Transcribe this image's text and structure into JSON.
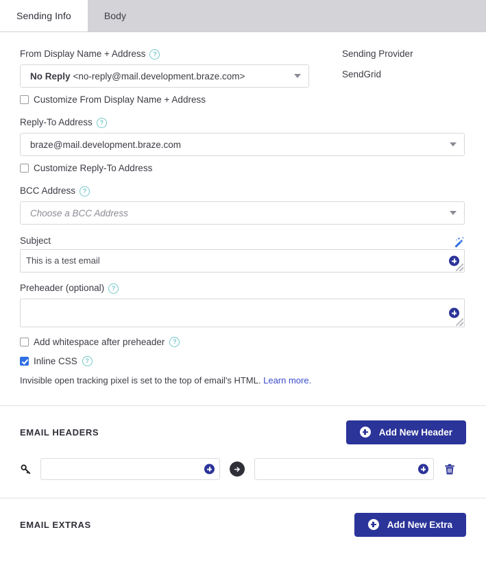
{
  "tabs": [
    {
      "label": "Sending Info",
      "active": true
    },
    {
      "label": "Body",
      "active": false
    }
  ],
  "form": {
    "from": {
      "label": "From Display Name + Address",
      "display_name": "No Reply",
      "address": "<no-reply@mail.development.braze.com>",
      "customize_label": "Customize From Display Name + Address",
      "customize_checked": false
    },
    "reply_to": {
      "label": "Reply-To Address",
      "value": "braze@mail.development.braze.com",
      "customize_label": "Customize Reply-To Address",
      "customize_checked": false
    },
    "bcc": {
      "label": "BCC Address",
      "placeholder": "Choose a BCC Address"
    },
    "subject": {
      "label": "Subject",
      "value": "This is a test email"
    },
    "preheader": {
      "label": "Preheader (optional)",
      "value": ""
    },
    "whitespace": {
      "label": "Add whitespace after preheader",
      "checked": false
    },
    "inline_css": {
      "label": "Inline CSS",
      "checked": true
    },
    "tracking_note": {
      "text": "Invisible open tracking pixel is set to the top of email's HTML.",
      "link_label": "Learn more."
    }
  },
  "sending_provider": {
    "label": "Sending Provider",
    "value": "SendGrid"
  },
  "email_headers": {
    "title": "EMAIL HEADERS",
    "add_button": "Add New Header",
    "rows": [
      {
        "key": "",
        "value": ""
      }
    ]
  },
  "email_extras": {
    "title": "EMAIL EXTRAS",
    "add_button": "Add New Extra"
  },
  "icons": {
    "help": "?",
    "key": "key-icon",
    "arrow": "arrow-right-icon",
    "trash": "trash-icon",
    "wand": "magic-wand-icon"
  },
  "colors": {
    "primary": "#2b3499",
    "checkbox_checked": "#2f6fe4",
    "help_icon": "#74c7c9",
    "link": "#3b4cca"
  }
}
